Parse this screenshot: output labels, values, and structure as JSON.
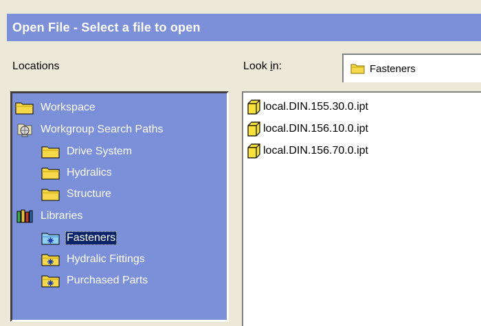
{
  "window": {
    "title": "Open File - Select a file to open"
  },
  "labels": {
    "locations": "Locations",
    "look_in": "Look in:"
  },
  "look_in": {
    "value": "Fasteners",
    "icon": "folder-icon"
  },
  "locations": {
    "items": [
      {
        "label": "Workspace",
        "icon": "folder-icon",
        "indent": 0,
        "selected": false
      },
      {
        "label": "Workgroup Search Paths",
        "icon": "network-folder-icon",
        "indent": 0,
        "selected": false
      },
      {
        "label": "Drive System",
        "icon": "folder-icon",
        "indent": 1,
        "selected": false
      },
      {
        "label": "Hydralics",
        "icon": "folder-icon",
        "indent": 1,
        "selected": false
      },
      {
        "label": "Structure",
        "icon": "folder-icon",
        "indent": 1,
        "selected": false
      },
      {
        "label": "Libraries",
        "icon": "books-icon",
        "indent": 0,
        "selected": false
      },
      {
        "label": "Fasteners",
        "icon": "library-folder-icon",
        "indent": 1,
        "selected": true
      },
      {
        "label": "Hydralic Fittings",
        "icon": "library-folder-icon",
        "indent": 1,
        "selected": false
      },
      {
        "label": "Purchased Parts",
        "icon": "library-folder-icon",
        "indent": 1,
        "selected": false
      }
    ]
  },
  "files": {
    "items": [
      {
        "name": "local.DIN.155.30.0.ipt",
        "icon": "part-file-icon"
      },
      {
        "name": "local.DIN.156.10.0.ipt",
        "icon": "part-file-icon"
      },
      {
        "name": "local.DIN.156.70.0.ipt",
        "icon": "part-file-icon"
      }
    ]
  },
  "colors": {
    "titlebar_bg": "#7b90d8",
    "locations_bg": "#7b90d8",
    "selection_bg": "#0a246a",
    "folder_yellow": "#f6d84a",
    "dialog_bg": "#ece9d8"
  }
}
